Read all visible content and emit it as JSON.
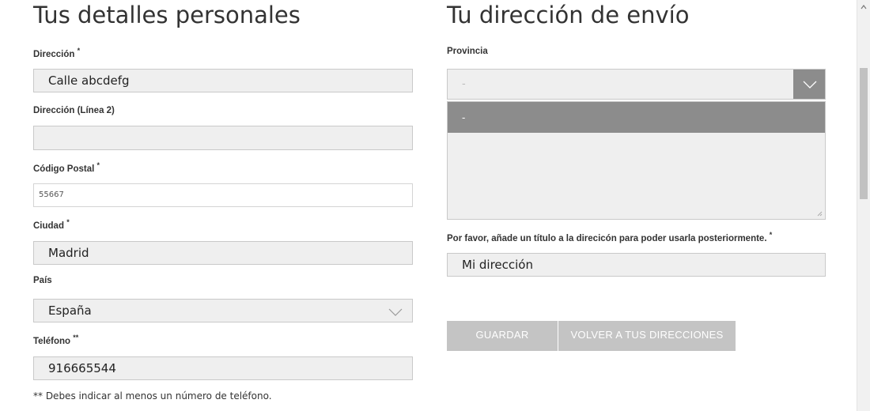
{
  "personal": {
    "title": "Tus detalles personales",
    "address_label": "Dirección",
    "address_value": "Calle abcdefg",
    "address2_label": "Dirección (Línea 2)",
    "address2_value": "",
    "postal_label": "Código Postal",
    "postal_value": "55667",
    "city_label": "Ciudad",
    "city_value": "Madrid",
    "country_label": "País",
    "country_value": "España",
    "phone_label": "Teléfono",
    "phone_value": "916665544",
    "required_mark": "*",
    "double_mark": "**",
    "phone_note": "** Debes indicar al menos un número de teléfono."
  },
  "shipping": {
    "title": "Tu dirección de envío",
    "province_label": "Provincia",
    "province_value": "-",
    "province_options": [
      "-"
    ],
    "address_title_label": "Por favor, añade un título a la direcicón para poder usarla posteriormente.",
    "address_title_mark": "*",
    "address_title_value": "Mi dirección"
  },
  "actions": {
    "save_label": "GUARDAR",
    "back_label": "VOLVER A TUS DIRECCIONES"
  },
  "colors": {
    "field_bg": "#efefef",
    "dropdown_highlight": "#8c8c8c",
    "button_bg": "#c4c4c4"
  },
  "icons": {
    "select_arrow": "chevron-down-icon",
    "resize": "resize-grip-icon"
  }
}
